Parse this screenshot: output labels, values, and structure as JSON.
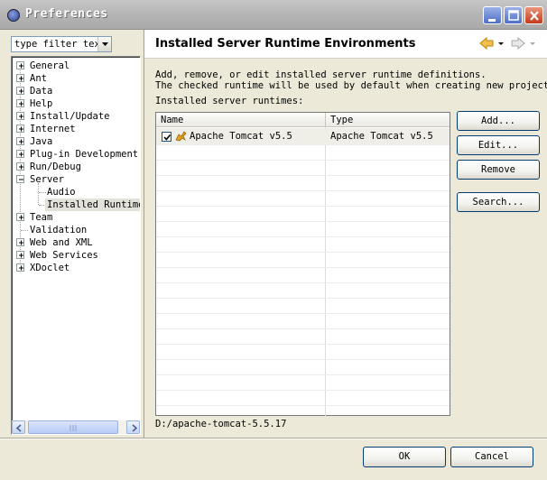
{
  "window": {
    "title": "Preferences"
  },
  "filter": {
    "text": "type filter tex"
  },
  "tree": {
    "items": [
      {
        "label": "General",
        "expandable": true
      },
      {
        "label": "Ant",
        "expandable": true
      },
      {
        "label": "Data",
        "expandable": true
      },
      {
        "label": "Help",
        "expandable": true
      },
      {
        "label": "Install/Update",
        "expandable": true
      },
      {
        "label": "Internet",
        "expandable": true
      },
      {
        "label": "Java",
        "expandable": true
      },
      {
        "label": "Plug-in Development",
        "expandable": true
      },
      {
        "label": "Run/Debug",
        "expandable": true
      },
      {
        "label": "Server",
        "expanded": true
      },
      {
        "label": "Audio",
        "child": true
      },
      {
        "label": "Installed Runtime",
        "child": true,
        "selected": true
      },
      {
        "label": "Team",
        "expandable": true
      },
      {
        "label": "Validation",
        "expandable": false
      },
      {
        "label": "Web and XML",
        "expandable": true
      },
      {
        "label": "Web Services",
        "expandable": true
      },
      {
        "label": "XDoclet",
        "expandable": true
      }
    ]
  },
  "page": {
    "title": "Installed Server Runtime Environments",
    "description_line1": "Add, remove, or edit installed server runtime definitions.",
    "description_line2": "The checked runtime will be used by default when creating new projects.",
    "list_label": "Installed server runtimes:"
  },
  "table": {
    "columns": [
      "Name",
      "Type"
    ],
    "rows": [
      {
        "name": "Apache Tomcat v5.5",
        "type": "Apache Tomcat v5.5",
        "checked": true
      }
    ]
  },
  "buttons": {
    "add": "Add...",
    "edit": "Edit...",
    "remove": "Remove",
    "search": "Search..."
  },
  "selected_path": "D:/apache-tomcat-5.5.17",
  "dialog": {
    "ok": "OK",
    "cancel": "Cancel"
  },
  "colors": {
    "accent": "#003c74",
    "title_bar": "#b5b5b5",
    "dialog_bg": "#ece9d8"
  },
  "icons": [
    "eclipse-icon",
    "minimize-icon",
    "maximize-icon",
    "close-icon",
    "dropdown-arrow-icon",
    "back-arrow-icon",
    "forward-arrow-icon",
    "checkbox-checked-icon",
    "tomcat-icon",
    "scroll-left-icon",
    "scroll-right-icon"
  ]
}
